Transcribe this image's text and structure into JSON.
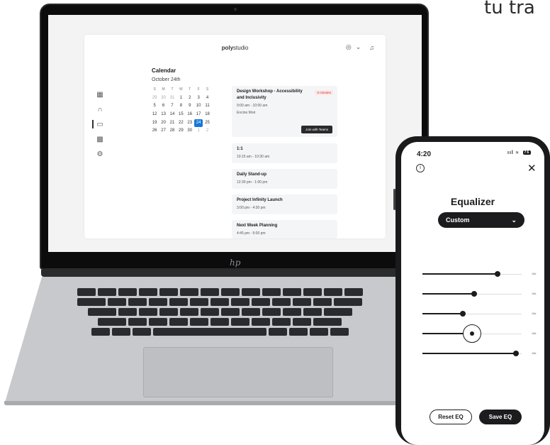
{
  "corner_text": "tu tra",
  "laptop": {
    "logo": "hp",
    "app": {
      "brand_bold": "poly",
      "brand_light": "studio",
      "header_icons": [
        "user-circle-icon",
        "chevron-down-icon",
        "bell-icon"
      ],
      "sidebar_icons": [
        "dashboard-icon",
        "headset-icon",
        "calendar-icon",
        "grid-icon",
        "gear-icon"
      ],
      "calendar": {
        "title": "Calendar",
        "month": "October 24th",
        "weekdays": [
          "S",
          "M",
          "T",
          "W",
          "T",
          "F",
          "S"
        ],
        "weeks": [
          [
            "29",
            "30",
            "31",
            "1",
            "2",
            "3",
            "4"
          ],
          [
            "5",
            "6",
            "7",
            "8",
            "9",
            "10",
            "11"
          ],
          [
            "12",
            "13",
            "14",
            "15",
            "16",
            "17",
            "18"
          ],
          [
            "19",
            "20",
            "21",
            "22",
            "23",
            "24",
            "25"
          ],
          [
            "26",
            "27",
            "28",
            "29",
            "30",
            "1",
            "2"
          ]
        ],
        "selected_day": "24",
        "accent": "#1677d9"
      },
      "events": [
        {
          "title": "Design Workshop - Accessibility and Inclusivity",
          "time": "9:00 am - 10:00 am",
          "location": "Encino Mori",
          "badge": "5 minutes",
          "action": "Join with Teams"
        },
        {
          "title": "1:1",
          "time": "10:15 am - 10:30 am"
        },
        {
          "title": "Daily Stand-up",
          "time": "12:30 pm - 1:00 pm"
        },
        {
          "title": "Project Infinity Launch",
          "time": "3:00 pm - 4:30 pm"
        },
        {
          "title": "Next Week Planning",
          "time": "4:45 pm - 5:00 pm"
        }
      ]
    }
  },
  "phone": {
    "status": {
      "time": "4:20",
      "signal": "ııl",
      "wifi": "≈",
      "battery": "76"
    },
    "info_icon": "info-icon",
    "close_icon": "close-icon",
    "title": "Equalizer",
    "preset": {
      "label": "Custom",
      "icon": "chevron-down-icon"
    },
    "bands": [
      {
        "label": "16k",
        "level": 0.76
      },
      {
        "label": "16k",
        "level": 0.52
      },
      {
        "label": "16k",
        "level": 0.41
      },
      {
        "label": "16k",
        "level": 0.5,
        "active": true
      },
      {
        "label": "16k",
        "level": 0.94
      }
    ],
    "reset_label": "Reset EQ",
    "save_label": "Save EQ"
  }
}
